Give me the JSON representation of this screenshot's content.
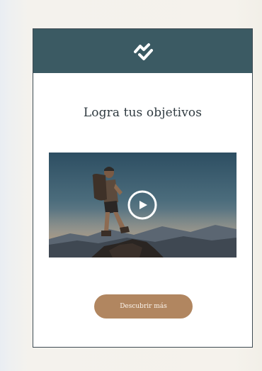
{
  "email": {
    "logo_icon": "zigzag-check-logo",
    "headline": "Logra tus objetivos",
    "video": {
      "thumbnail_icon": "hiker-on-summit-image",
      "play_icon": "play-circle-icon"
    },
    "cta_label": "Descubrir más"
  },
  "colors": {
    "page_background": "#f5f2ec",
    "card_background": "#ffffff",
    "card_border": "#3d4a52",
    "header_background": "#3b5a63",
    "headline_text": "#2f3a40",
    "cta_background": "#b18660",
    "cta_text": "#fdf6ee"
  }
}
